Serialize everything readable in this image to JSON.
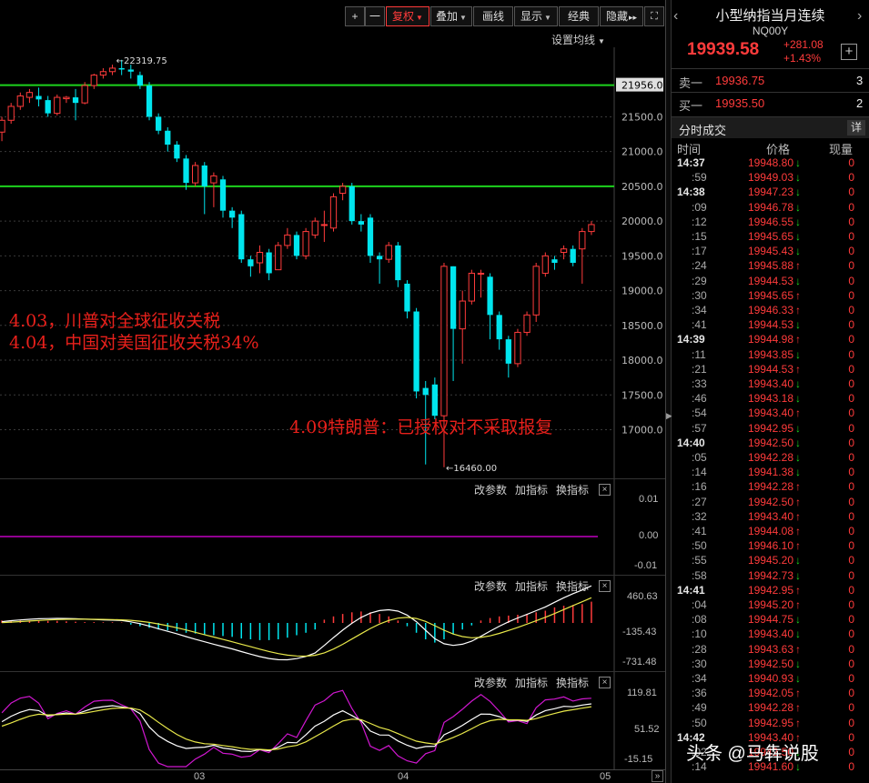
{
  "toolbar": {
    "plus": "+",
    "minus": "一",
    "fuquan": "复权",
    "diejia": "叠加",
    "huaxian": "画线",
    "xianshi": "显示",
    "jingdian": "经典",
    "yincang": "隐藏",
    "arrows": "▸▸",
    "expand": "⛶"
  },
  "set_ma": "设置均线",
  "price_axis": [
    "21956.0",
    "21500.0",
    "21000.0",
    "20500.0",
    "20000.0",
    "19500.0",
    "19000.0",
    "18500.0",
    "18000.0",
    "17500.0",
    "17000.0"
  ],
  "annotations": {
    "high": "22319.75",
    "low": "16460.00",
    "note1": "4.03，川普对全球征收关税",
    "note2": "4.04，中国对美国征收关税34%",
    "note3": "4.09特朗普：已授权对不采取报复"
  },
  "indicator_panel_1": {
    "btn_param": "改参数",
    "btn_add": "加指标",
    "btn_swap": "换指标",
    "close": "×",
    "axis": [
      "0.01",
      "0.00",
      "-0.01"
    ]
  },
  "indicator_panel_2": {
    "btn_param": "改参数",
    "btn_add": "加指标",
    "btn_swap": "换指标",
    "close": "×",
    "axis": [
      "460.63",
      "-135.43",
      "-731.48"
    ]
  },
  "indicator_panel_3": {
    "btn_param": "改参数",
    "btn_add": "加指标",
    "btn_swap": "换指标",
    "close": "×",
    "axis": [
      "119.81",
      "51.52",
      "-15.15"
    ]
  },
  "x_axis": [
    "03",
    "04",
    "05"
  ],
  "quote": {
    "name": "小型纳指当月连续",
    "code": "NQ00Y",
    "price": "19939.58",
    "change": "+281.08",
    "change_pct": "+1.43%",
    "add_btn": "+",
    "ask_label": "卖一",
    "ask_price": "19936.75",
    "ask_vol": "3",
    "bid_label": "买一",
    "bid_price": "19935.50",
    "bid_vol": "2",
    "ticks_title": "分时成交",
    "ticks_detail": "详",
    "col_time": "时间",
    "col_price": "价格",
    "col_vol": "现量"
  },
  "ticks": [
    {
      "time": "14:37",
      "price": "19948.80",
      "dir": "down",
      "vol": "0"
    },
    {
      "time": ":59",
      "price": "19949.03",
      "dir": "down",
      "vol": "0"
    },
    {
      "time": "14:38",
      "price": "19947.23",
      "dir": "down",
      "vol": "0"
    },
    {
      "time": ":09",
      "price": "19946.78",
      "dir": "down",
      "vol": "0"
    },
    {
      "time": ":12",
      "price": "19946.55",
      "dir": "down",
      "vol": "0"
    },
    {
      "time": ":15",
      "price": "19945.65",
      "dir": "down",
      "vol": "0"
    },
    {
      "time": ":17",
      "price": "19945.43",
      "dir": "down",
      "vol": "0"
    },
    {
      "time": ":24",
      "price": "19945.88",
      "dir": "up",
      "vol": "0"
    },
    {
      "time": ":29",
      "price": "19944.53",
      "dir": "down",
      "vol": "0"
    },
    {
      "time": ":30",
      "price": "19945.65",
      "dir": "up",
      "vol": "0"
    },
    {
      "time": ":34",
      "price": "19946.33",
      "dir": "up",
      "vol": "0"
    },
    {
      "time": ":41",
      "price": "19944.53",
      "dir": "down",
      "vol": "0"
    },
    {
      "time": "14:39",
      "price": "19944.98",
      "dir": "up",
      "vol": "0"
    },
    {
      "time": ":11",
      "price": "19943.85",
      "dir": "down",
      "vol": "0"
    },
    {
      "time": ":21",
      "price": "19944.53",
      "dir": "up",
      "vol": "0"
    },
    {
      "time": ":33",
      "price": "19943.40",
      "dir": "down",
      "vol": "0"
    },
    {
      "time": ":46",
      "price": "19943.18",
      "dir": "down",
      "vol": "0"
    },
    {
      "time": ":54",
      "price": "19943.40",
      "dir": "up",
      "vol": "0"
    },
    {
      "time": ":57",
      "price": "19942.95",
      "dir": "down",
      "vol": "0"
    },
    {
      "time": "14:40",
      "price": "19942.50",
      "dir": "down",
      "vol": "0"
    },
    {
      "time": ":05",
      "price": "19942.28",
      "dir": "down",
      "vol": "0"
    },
    {
      "time": ":14",
      "price": "19941.38",
      "dir": "down",
      "vol": "0"
    },
    {
      "time": ":16",
      "price": "19942.28",
      "dir": "up",
      "vol": "0"
    },
    {
      "time": ":27",
      "price": "19942.50",
      "dir": "up",
      "vol": "0"
    },
    {
      "time": ":32",
      "price": "19943.40",
      "dir": "up",
      "vol": "0"
    },
    {
      "time": ":41",
      "price": "19944.08",
      "dir": "up",
      "vol": "0"
    },
    {
      "time": ":50",
      "price": "19946.10",
      "dir": "up",
      "vol": "0"
    },
    {
      "time": ":55",
      "price": "19945.20",
      "dir": "down",
      "vol": "0"
    },
    {
      "time": ":58",
      "price": "19942.73",
      "dir": "down",
      "vol": "0"
    },
    {
      "time": "14:41",
      "price": "19942.95",
      "dir": "up",
      "vol": "0"
    },
    {
      "time": ":04",
      "price": "19945.20",
      "dir": "up",
      "vol": "0"
    },
    {
      "time": ":08",
      "price": "19944.75",
      "dir": "down",
      "vol": "0"
    },
    {
      "time": ":10",
      "price": "19943.40",
      "dir": "down",
      "vol": "0"
    },
    {
      "time": ":28",
      "price": "19943.63",
      "dir": "up",
      "vol": "0"
    },
    {
      "time": ":30",
      "price": "19942.50",
      "dir": "down",
      "vol": "0"
    },
    {
      "time": ":34",
      "price": "19940.93",
      "dir": "down",
      "vol": "0"
    },
    {
      "time": ":36",
      "price": "19942.05",
      "dir": "up",
      "vol": "0"
    },
    {
      "time": ":49",
      "price": "19942.28",
      "dir": "up",
      "vol": "0"
    },
    {
      "time": ":50",
      "price": "19942.95",
      "dir": "up",
      "vol": "0"
    },
    {
      "time": "14:42",
      "price": "19943.40",
      "dir": "up",
      "vol": "0"
    },
    {
      "time": ":02",
      "price": "19942.50",
      "dir": "down",
      "vol": "0"
    },
    {
      "time": ":14",
      "price": "19941.60",
      "dir": "down",
      "vol": "0"
    }
  ],
  "watermark": "头条 @马犇说股",
  "colors": {
    "up": "#ff3b3b",
    "down": "#00e5ee",
    "support": "#1dd31d",
    "background": "#000000"
  },
  "chart_data": {
    "type": "candlestick",
    "ylim": [
      16300,
      22500
    ],
    "horizontal_lines": [
      21956.0,
      20500.0
    ],
    "high_marker": 22319.75,
    "low_marker": 16460.0,
    "candles": [
      [
        21280,
        21450,
        21150,
        21500
      ],
      [
        21450,
        21650,
        21400,
        21700
      ],
      [
        21650,
        21800,
        21600,
        21850
      ],
      [
        21780,
        21850,
        21700,
        21900
      ],
      [
        21800,
        21750,
        21650,
        21920
      ],
      [
        21740,
        21550,
        21500,
        21800
      ],
      [
        21550,
        21780,
        21520,
        21820
      ],
      [
        21760,
        21780,
        21700,
        21800
      ],
      [
        21780,
        21700,
        21450,
        21900
      ],
      [
        21700,
        21950,
        21680,
        22000
      ],
      [
        21950,
        22100,
        21900,
        22120
      ],
      [
        22100,
        22150,
        22050,
        22200
      ],
      [
        22150,
        22200,
        22100,
        22250
      ],
      [
        22200,
        22180,
        22100,
        22320
      ],
      [
        22180,
        22150,
        22050,
        22250
      ],
      [
        22100,
        21950,
        21900,
        22150
      ],
      [
        21950,
        21500,
        21450,
        22000
      ],
      [
        21500,
        21300,
        21250,
        21550
      ],
      [
        21300,
        21100,
        21000,
        21350
      ],
      [
        21100,
        20900,
        20850,
        21150
      ],
      [
        20900,
        20550,
        20450,
        20950
      ],
      [
        20550,
        20800,
        20500,
        20850
      ],
      [
        20800,
        20500,
        20100,
        20850
      ],
      [
        20550,
        20650,
        20200,
        20700
      ],
      [
        20600,
        20150,
        20050,
        20650
      ],
      [
        20150,
        20050,
        19900,
        20200
      ],
      [
        20100,
        19450,
        19400,
        20150
      ],
      [
        19450,
        19350,
        19200,
        19500
      ],
      [
        19400,
        19550,
        19250,
        19650
      ],
      [
        19550,
        19250,
        19150,
        19600
      ],
      [
        19300,
        19650,
        19300,
        19700
      ],
      [
        19650,
        19800,
        19600,
        19900
      ],
      [
        19800,
        19500,
        19450,
        19850
      ],
      [
        19500,
        19850,
        19450,
        19900
      ],
      [
        19800,
        20000,
        19750,
        20050
      ],
      [
        19950,
        19950,
        19700,
        20150
      ],
      [
        19900,
        20350,
        19850,
        20400
      ],
      [
        20400,
        20500,
        20300,
        20550
      ],
      [
        20500,
        20000,
        19950,
        20550
      ],
      [
        20000,
        19950,
        19850,
        20100
      ],
      [
        20050,
        19500,
        19400,
        20100
      ],
      [
        19500,
        19450,
        19100,
        19550
      ],
      [
        19450,
        19650,
        19400,
        19700
      ],
      [
        19650,
        19150,
        19050,
        19700
      ],
      [
        19100,
        18700,
        18600,
        19150
      ],
      [
        18700,
        17550,
        17450,
        18750
      ],
      [
        17600,
        17500,
        16500,
        17700
      ],
      [
        17650,
        17200,
        17150,
        17750
      ],
      [
        17200,
        19350,
        16460,
        19400
      ],
      [
        19350,
        18450,
        17700,
        19350
      ],
      [
        18450,
        18850,
        17950,
        19000
      ],
      [
        18850,
        19250,
        18800,
        19300
      ],
      [
        19250,
        19250,
        18900,
        19300
      ],
      [
        19200,
        18650,
        18300,
        19250
      ],
      [
        18650,
        18300,
        18150,
        18700
      ],
      [
        18300,
        17950,
        17750,
        18350
      ],
      [
        17950,
        18400,
        17900,
        18450
      ],
      [
        18400,
        18650,
        18350,
        18700
      ],
      [
        18650,
        19350,
        18550,
        19400
      ],
      [
        19250,
        19500,
        19200,
        19550
      ],
      [
        19450,
        19400,
        19300,
        19500
      ],
      [
        19550,
        19600,
        19450,
        19650
      ],
      [
        19600,
        19400,
        19350,
        19650
      ],
      [
        19600,
        19850,
        19100,
        19900
      ],
      [
        19850,
        19950,
        19800,
        20000
      ]
    ],
    "macd_hist": [
      30,
      30,
      30,
      30,
      30,
      25,
      25,
      20,
      15,
      10,
      10,
      8,
      8,
      5,
      -20,
      -40,
      -60,
      -80,
      -90,
      -100,
      -120,
      -130,
      -140,
      -150,
      -160,
      -170,
      -190,
      -200,
      -210,
      -210,
      -200,
      -180,
      -150,
      -120,
      -80,
      40,
      80,
      110,
      130,
      140,
      130,
      110,
      80,
      30,
      -40,
      -120,
      -200,
      -240,
      -200,
      -140,
      -80,
      -30,
      30,
      60,
      80,
      90,
      100,
      110,
      130,
      150,
      190,
      210,
      220,
      230,
      260
    ],
    "xaxis_ticks": [
      "03",
      "04",
      "05"
    ]
  }
}
